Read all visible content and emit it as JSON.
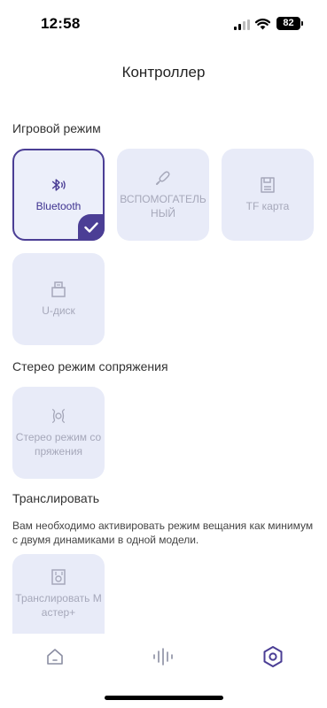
{
  "status_bar": {
    "time": "12:58",
    "battery": "82"
  },
  "page_title": "Контроллер",
  "sections": {
    "game_mode": {
      "title": "Игровой режим",
      "tiles": [
        {
          "label": "Bluetooth",
          "icon": "bluetooth-icon",
          "selected": true
        },
        {
          "label": "ВСПОМОГАТЕЛЬНЫЙ",
          "icon": "aux-cable-icon",
          "selected": false
        },
        {
          "label": "TF карта",
          "icon": "sd-card-icon",
          "selected": false
        },
        {
          "label": "U-диск",
          "icon": "usb-drive-icon",
          "selected": false
        }
      ]
    },
    "stereo": {
      "title": "Стерео режим сопряжения",
      "tiles": [
        {
          "label": "Стерео режим сопряжения",
          "icon": "stereo-pair-icon",
          "selected": false
        }
      ]
    },
    "broadcast": {
      "title": "Транслировать",
      "note": "Вам необходимо активировать режим вещания как минимум с двумя динамиками в одной модели.",
      "tiles": [
        {
          "label": "Транслировать Мастер+",
          "icon": "speaker-icon",
          "selected": false
        }
      ]
    }
  },
  "bottom_nav": [
    {
      "icon": "home-icon",
      "active": false
    },
    {
      "icon": "equalizer-icon",
      "active": false
    },
    {
      "icon": "hexagon-settings-icon",
      "active": true
    }
  ],
  "colors": {
    "accent": "#4b3e95",
    "tile_bg": "#e8ebf8",
    "inactive_text": "#a6a8ba"
  }
}
